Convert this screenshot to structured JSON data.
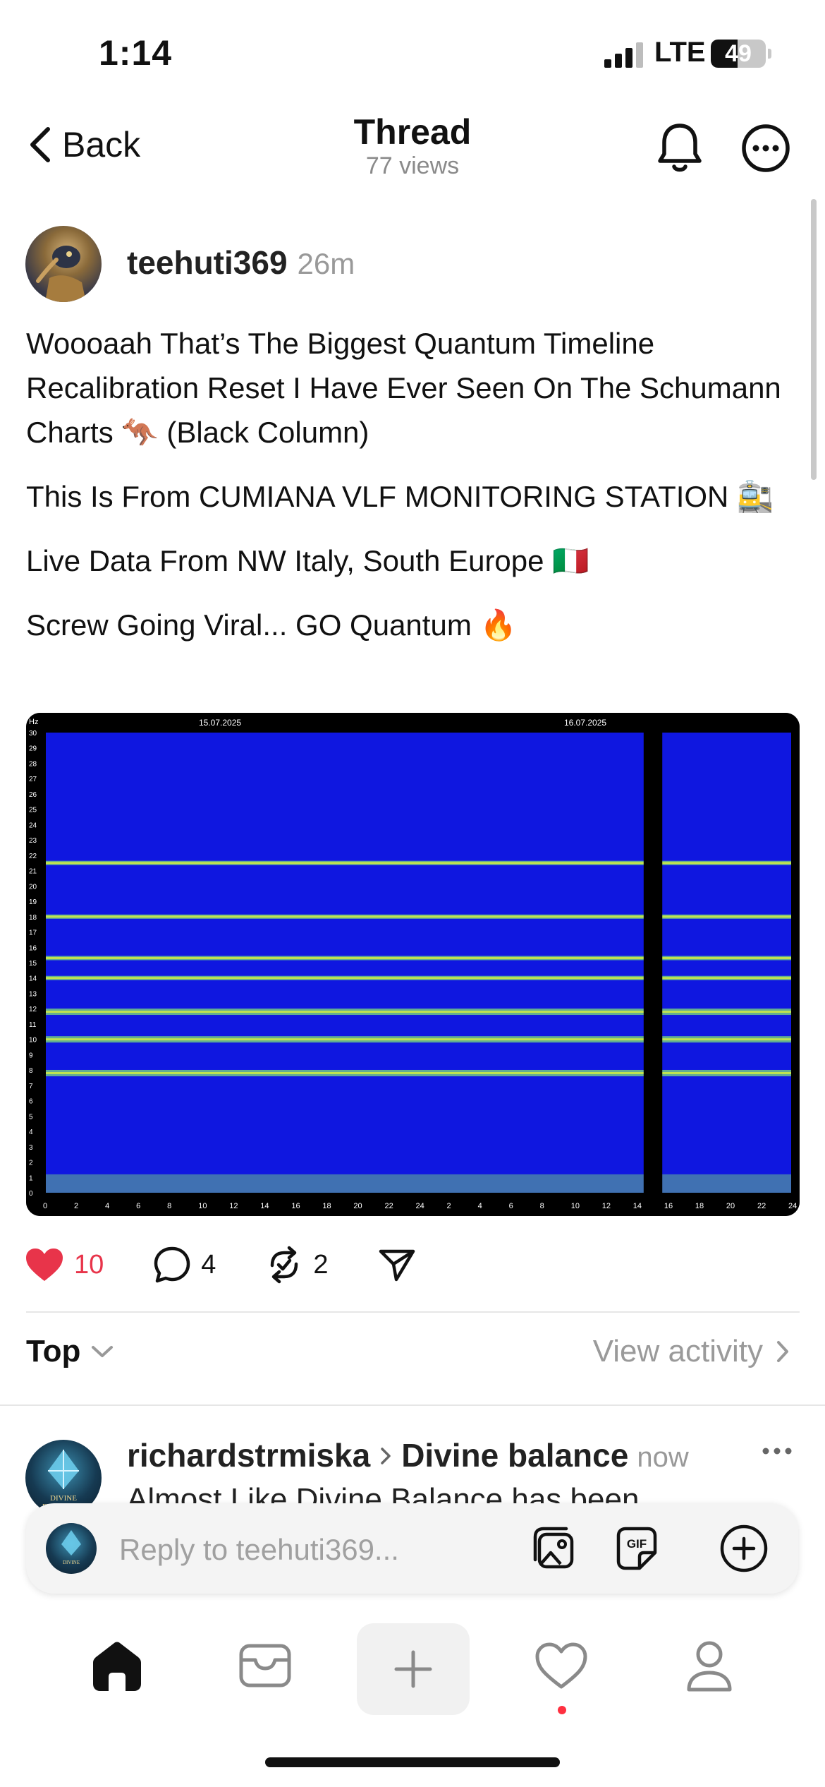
{
  "status_bar": {
    "time": "1:14",
    "network": "LTE",
    "battery_level": "49",
    "battery_fraction": 0.49
  },
  "header": {
    "back_label": "Back",
    "title": "Thread",
    "subtitle": "77 views"
  },
  "post": {
    "username": "teehuti369",
    "time": "26m",
    "paragraphs": [
      "Woooaah That’s The Biggest Quantum Timeline Recalibration Reset I Have Ever Seen On The Schumann Charts 🦘  (Black Column)",
      "This Is From CUMIANA VLF MONITORING STATION 🚉",
      "Live Data From NW Italy, South Europe 🇮🇹",
      "Screw Going Viral... GO Quantum 🔥"
    ],
    "likes": "10",
    "comments": "4",
    "reposts": "2"
  },
  "spectrogram": {
    "unit_label": "Hz",
    "date_labels": [
      "15.07.2025",
      "16.07.2025"
    ],
    "y_ticks": [
      "0",
      "1",
      "2",
      "3",
      "4",
      "5",
      "6",
      "7",
      "8",
      "9",
      "10",
      "11",
      "12",
      "13",
      "14",
      "15",
      "16",
      "17",
      "18",
      "19",
      "20",
      "21",
      "22",
      "23",
      "24",
      "25",
      "26",
      "27",
      "28",
      "29",
      "30"
    ],
    "x_ticks": [
      "0",
      "2",
      "4",
      "6",
      "8",
      "10",
      "12",
      "14",
      "16",
      "18",
      "20",
      "22",
      "24",
      "2",
      "4",
      "6",
      "8",
      "10",
      "12",
      "14",
      "16",
      "18",
      "20",
      "22",
      "24"
    ],
    "bands_hz": [
      7.8,
      10.0,
      11.8,
      14.0,
      15.3,
      18.0,
      21.5
    ],
    "blackout_hours": [
      38.5,
      39.7
    ],
    "colors": {
      "background": "#0f17e0",
      "band": "#7de07a",
      "band_core": "#d8f040",
      "blackout": "#000000"
    }
  },
  "sort": {
    "label": "Top",
    "activity_label": "View activity"
  },
  "reply": {
    "username": "richardstrmiska",
    "topic": "Divine balance",
    "time": "now",
    "preview_text": "Almost Like Divine Balance has been"
  },
  "composer": {
    "placeholder": "Reply to teehuti369..."
  },
  "avatar_labels": {
    "reply_avatar_text": "DIVINE FREQUENCY"
  },
  "colors": {
    "like": "#e8344a",
    "muted": "#999999",
    "activity_dot": "#ff3040"
  }
}
